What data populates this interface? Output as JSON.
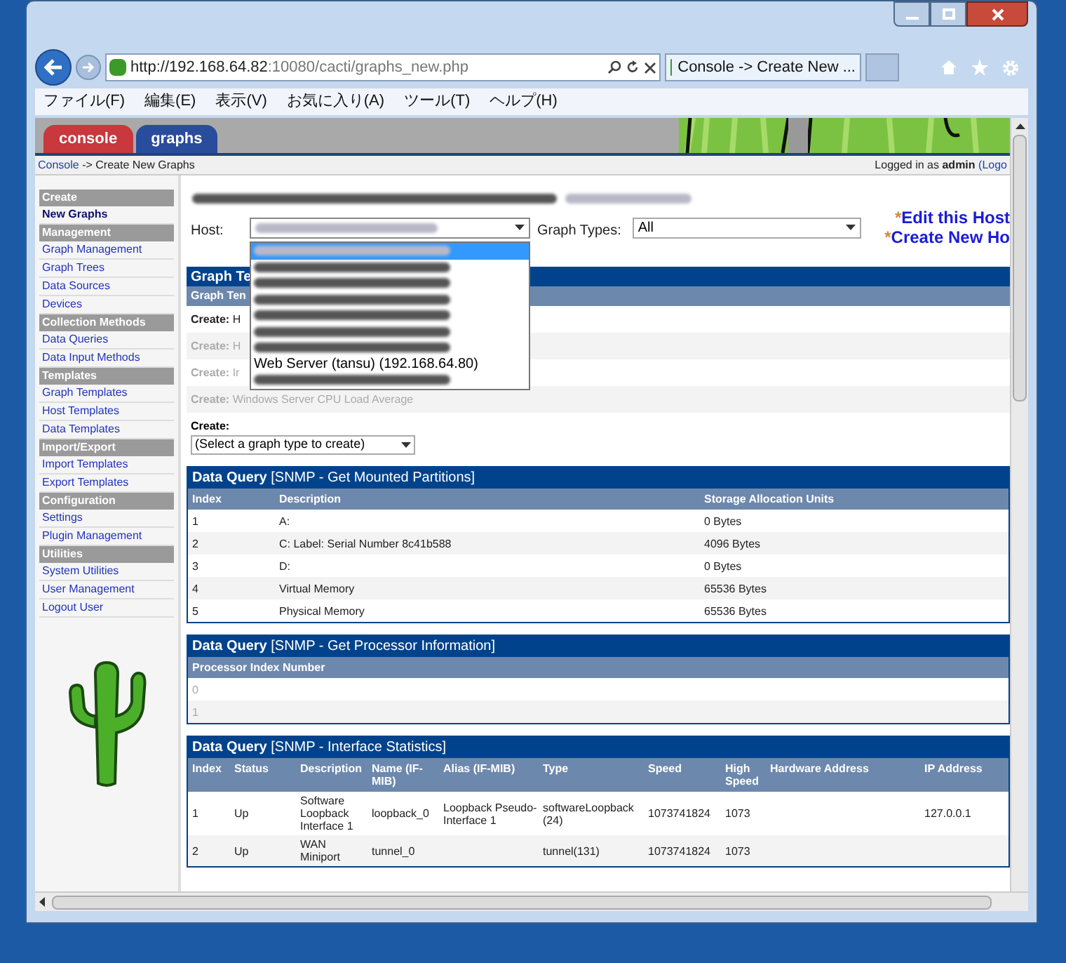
{
  "browser": {
    "url_host": "http://192.168.64.82",
    "url_path": ":10080/cacti/graphs_new.php",
    "tab_title": "Console -> Create New ...",
    "menu": [
      "ファイル(F)",
      "編集(E)",
      "表示(V)",
      "お気に入り(A)",
      "ツール(T)",
      "ヘルプ(H)"
    ]
  },
  "app_tabs": [
    {
      "label": "console",
      "color": "#c8383c"
    },
    {
      "label": "graphs",
      "color": "#2a4c9c"
    }
  ],
  "breadcrumb": {
    "link": "Console",
    "rest": "-> Create New Graphs"
  },
  "login": {
    "prefix": "Logged in as",
    "user": "admin",
    "link": "(Logo"
  },
  "sidebar": [
    {
      "heading": "Create",
      "items": [
        {
          "label": "New Graphs",
          "selected": true
        }
      ]
    },
    {
      "heading": "Management",
      "items": [
        {
          "label": "Graph Management",
          "selected": false
        },
        {
          "label": "Graph Trees",
          "selected": false
        },
        {
          "label": "Data Sources",
          "selected": false
        },
        {
          "label": "Devices",
          "selected": false
        }
      ]
    },
    {
      "heading": "Collection Methods",
      "items": [
        {
          "label": "Data Queries",
          "selected": false
        },
        {
          "label": "Data Input Methods",
          "selected": false
        }
      ]
    },
    {
      "heading": "Templates",
      "items": [
        {
          "label": "Graph Templates",
          "selected": false
        },
        {
          "label": "Host Templates",
          "selected": false
        },
        {
          "label": "Data Templates",
          "selected": false
        }
      ]
    },
    {
      "heading": "Import/Export",
      "items": [
        {
          "label": "Import Templates",
          "selected": false
        },
        {
          "label": "Export Templates",
          "selected": false
        }
      ]
    },
    {
      "heading": "Configuration",
      "items": [
        {
          "label": "Settings",
          "selected": false
        },
        {
          "label": "Plugin Management",
          "selected": false
        }
      ]
    },
    {
      "heading": "Utilities",
      "items": [
        {
          "label": "System Utilities",
          "selected": false
        },
        {
          "label": "User Management",
          "selected": false
        },
        {
          "label": "Logout User",
          "selected": false
        }
      ]
    }
  ],
  "host_form": {
    "host_label": "Host:",
    "graph_types_label": "Graph Types:",
    "graph_types_value": "All",
    "links": [
      {
        "mark": "*",
        "label": "Edit this Host"
      },
      {
        "mark": "*",
        "label": "Create New Ho"
      }
    ]
  },
  "host_dropdown": [
    {
      "kind": "blurred",
      "selected": true
    },
    {
      "kind": "blurred",
      "selected": false
    },
    {
      "kind": "blurred",
      "selected": false
    },
    {
      "kind": "blurred",
      "selected": false
    },
    {
      "kind": "blurred",
      "selected": false
    },
    {
      "kind": "blurred",
      "selected": false
    },
    {
      "kind": "blurred",
      "selected": false
    },
    {
      "kind": "text",
      "text": "Web Server (tansu) (192.168.64.80)",
      "selected": false
    },
    {
      "kind": "blurred",
      "selected": false
    }
  ],
  "graph_templates": {
    "title": "Graph Te",
    "subtitle": "Graph Ten",
    "rows": [
      {
        "prefix": "Create:",
        "rest": "H",
        "disabled": false
      },
      {
        "prefix": "Create:",
        "rest": "H",
        "disabled": true
      },
      {
        "prefix": "Create:",
        "rest": "Ir",
        "disabled": true
      },
      {
        "prefix": "Create:",
        "rest": "Windows Server CPU Load Average",
        "disabled": true
      }
    ],
    "create_label": "Create:",
    "create_select": "(Select a graph type to create)"
  },
  "data_queries": [
    {
      "label": "Data Query",
      "name": "[SNMP - Get Mounted Partitions]",
      "columns": [
        "Index",
        "Description",
        "Storage Allocation Units"
      ],
      "rows": [
        {
          "cells": [
            "1",
            "A:",
            "0 Bytes"
          ],
          "disabled": false
        },
        {
          "cells": [
            "2",
            "C: Label: Serial Number 8c41b588",
            "4096 Bytes"
          ],
          "disabled": false
        },
        {
          "cells": [
            "3",
            "D:",
            "0 Bytes"
          ],
          "disabled": false
        },
        {
          "cells": [
            "4",
            "Virtual Memory",
            "65536 Bytes"
          ],
          "disabled": false
        },
        {
          "cells": [
            "5",
            "Physical Memory",
            "65536 Bytes"
          ],
          "disabled": false
        }
      ]
    },
    {
      "label": "Data Query",
      "name": "[SNMP - Get Processor Information]",
      "columns": [
        "Processor Index Number"
      ],
      "rows": [
        {
          "cells": [
            "0"
          ],
          "disabled": true
        },
        {
          "cells": [
            "1"
          ],
          "disabled": true
        }
      ]
    },
    {
      "label": "Data Query",
      "name": "[SNMP - Interface Statistics]",
      "columns": [
        "Index",
        "Status",
        "Description",
        "Name (IF-MIB)",
        "Alias (IF-MIB)",
        "Type",
        "Speed",
        "High Speed",
        "Hardware Address",
        "IP Address"
      ],
      "rows": [
        {
          "cells": [
            "1",
            "Up",
            "Software Loopback Interface 1",
            "loopback_0",
            "Loopback Pseudo-Interface 1",
            "softwareLoopback (24)",
            "1073741824",
            "1073",
            null,
            "127.0.0.1"
          ],
          "disabled": false
        },
        {
          "cells": [
            "2",
            "Up",
            "WAN Miniport",
            "tunnel_0",
            null,
            "tunnel(131)",
            "1073741824",
            "1073",
            null,
            null
          ],
          "disabled": false
        }
      ]
    }
  ]
}
